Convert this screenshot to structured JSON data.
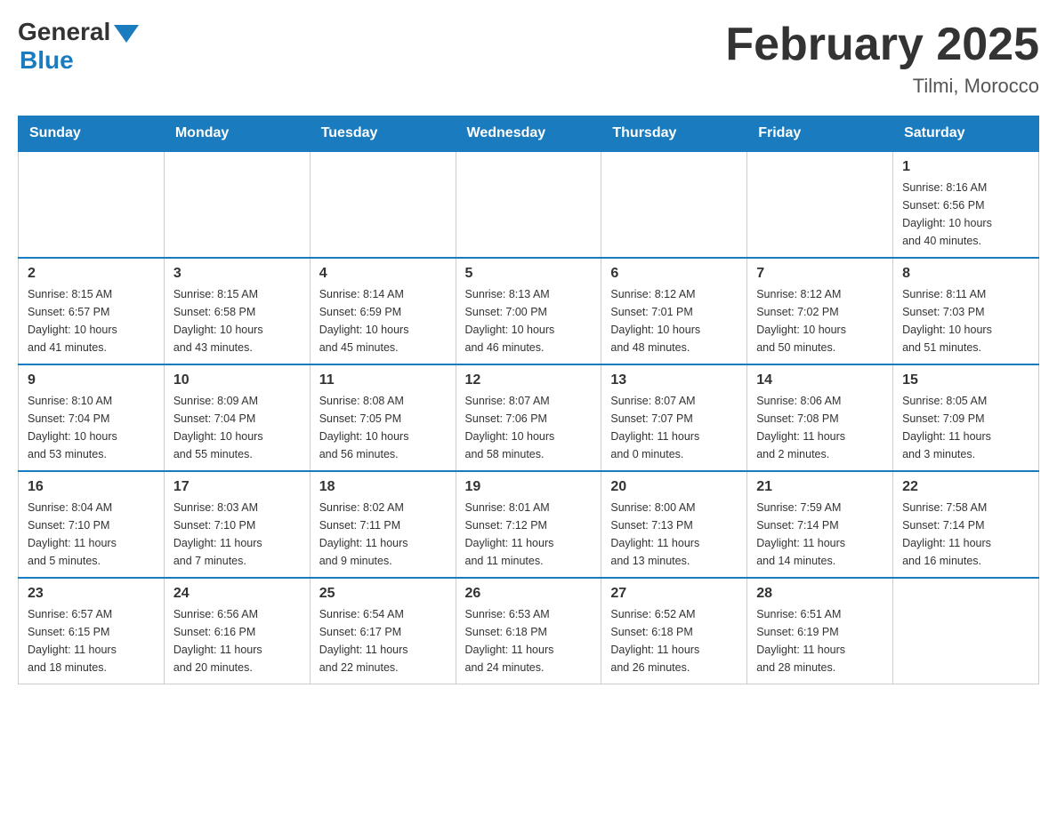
{
  "logo": {
    "general": "General",
    "blue": "Blue"
  },
  "title": "February 2025",
  "location": "Tilmi, Morocco",
  "days_of_week": [
    "Sunday",
    "Monday",
    "Tuesday",
    "Wednesday",
    "Thursday",
    "Friday",
    "Saturday"
  ],
  "weeks": [
    [
      {
        "day": "",
        "info": ""
      },
      {
        "day": "",
        "info": ""
      },
      {
        "day": "",
        "info": ""
      },
      {
        "day": "",
        "info": ""
      },
      {
        "day": "",
        "info": ""
      },
      {
        "day": "",
        "info": ""
      },
      {
        "day": "1",
        "info": "Sunrise: 8:16 AM\nSunset: 6:56 PM\nDaylight: 10 hours\nand 40 minutes."
      }
    ],
    [
      {
        "day": "2",
        "info": "Sunrise: 8:15 AM\nSunset: 6:57 PM\nDaylight: 10 hours\nand 41 minutes."
      },
      {
        "day": "3",
        "info": "Sunrise: 8:15 AM\nSunset: 6:58 PM\nDaylight: 10 hours\nand 43 minutes."
      },
      {
        "day": "4",
        "info": "Sunrise: 8:14 AM\nSunset: 6:59 PM\nDaylight: 10 hours\nand 45 minutes."
      },
      {
        "day": "5",
        "info": "Sunrise: 8:13 AM\nSunset: 7:00 PM\nDaylight: 10 hours\nand 46 minutes."
      },
      {
        "day": "6",
        "info": "Sunrise: 8:12 AM\nSunset: 7:01 PM\nDaylight: 10 hours\nand 48 minutes."
      },
      {
        "day": "7",
        "info": "Sunrise: 8:12 AM\nSunset: 7:02 PM\nDaylight: 10 hours\nand 50 minutes."
      },
      {
        "day": "8",
        "info": "Sunrise: 8:11 AM\nSunset: 7:03 PM\nDaylight: 10 hours\nand 51 minutes."
      }
    ],
    [
      {
        "day": "9",
        "info": "Sunrise: 8:10 AM\nSunset: 7:04 PM\nDaylight: 10 hours\nand 53 minutes."
      },
      {
        "day": "10",
        "info": "Sunrise: 8:09 AM\nSunset: 7:04 PM\nDaylight: 10 hours\nand 55 minutes."
      },
      {
        "day": "11",
        "info": "Sunrise: 8:08 AM\nSunset: 7:05 PM\nDaylight: 10 hours\nand 56 minutes."
      },
      {
        "day": "12",
        "info": "Sunrise: 8:07 AM\nSunset: 7:06 PM\nDaylight: 10 hours\nand 58 minutes."
      },
      {
        "day": "13",
        "info": "Sunrise: 8:07 AM\nSunset: 7:07 PM\nDaylight: 11 hours\nand 0 minutes."
      },
      {
        "day": "14",
        "info": "Sunrise: 8:06 AM\nSunset: 7:08 PM\nDaylight: 11 hours\nand 2 minutes."
      },
      {
        "day": "15",
        "info": "Sunrise: 8:05 AM\nSunset: 7:09 PM\nDaylight: 11 hours\nand 3 minutes."
      }
    ],
    [
      {
        "day": "16",
        "info": "Sunrise: 8:04 AM\nSunset: 7:10 PM\nDaylight: 11 hours\nand 5 minutes."
      },
      {
        "day": "17",
        "info": "Sunrise: 8:03 AM\nSunset: 7:10 PM\nDaylight: 11 hours\nand 7 minutes."
      },
      {
        "day": "18",
        "info": "Sunrise: 8:02 AM\nSunset: 7:11 PM\nDaylight: 11 hours\nand 9 minutes."
      },
      {
        "day": "19",
        "info": "Sunrise: 8:01 AM\nSunset: 7:12 PM\nDaylight: 11 hours\nand 11 minutes."
      },
      {
        "day": "20",
        "info": "Sunrise: 8:00 AM\nSunset: 7:13 PM\nDaylight: 11 hours\nand 13 minutes."
      },
      {
        "day": "21",
        "info": "Sunrise: 7:59 AM\nSunset: 7:14 PM\nDaylight: 11 hours\nand 14 minutes."
      },
      {
        "day": "22",
        "info": "Sunrise: 7:58 AM\nSunset: 7:14 PM\nDaylight: 11 hours\nand 16 minutes."
      }
    ],
    [
      {
        "day": "23",
        "info": "Sunrise: 6:57 AM\nSunset: 6:15 PM\nDaylight: 11 hours\nand 18 minutes."
      },
      {
        "day": "24",
        "info": "Sunrise: 6:56 AM\nSunset: 6:16 PM\nDaylight: 11 hours\nand 20 minutes."
      },
      {
        "day": "25",
        "info": "Sunrise: 6:54 AM\nSunset: 6:17 PM\nDaylight: 11 hours\nand 22 minutes."
      },
      {
        "day": "26",
        "info": "Sunrise: 6:53 AM\nSunset: 6:18 PM\nDaylight: 11 hours\nand 24 minutes."
      },
      {
        "day": "27",
        "info": "Sunrise: 6:52 AM\nSunset: 6:18 PM\nDaylight: 11 hours\nand 26 minutes."
      },
      {
        "day": "28",
        "info": "Sunrise: 6:51 AM\nSunset: 6:19 PM\nDaylight: 11 hours\nand 28 minutes."
      },
      {
        "day": "",
        "info": ""
      }
    ]
  ]
}
